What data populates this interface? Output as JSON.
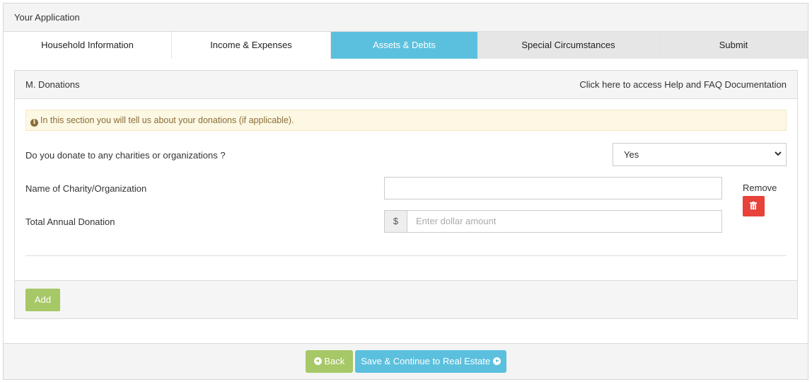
{
  "header": {
    "title": "Your Application"
  },
  "tabs": [
    {
      "label": "Household Information",
      "state": "done"
    },
    {
      "label": "Income & Expenses",
      "state": "done"
    },
    {
      "label": "Assets & Debts",
      "state": "active"
    },
    {
      "label": "Special Circumstances",
      "state": "pending"
    },
    {
      "label": "Submit",
      "state": "pending"
    }
  ],
  "panel": {
    "title": "M. Donations",
    "help_link": "Click here to access Help and FAQ Documentation",
    "alert": "In this section you will tell us about your donations (if applicable).",
    "question": "Do you donate to any charities or organizations ?",
    "answer": "Yes",
    "name_label": "Name of Charity/Organization",
    "name_value": "",
    "donation_label": "Total Annual Donation",
    "currency_symbol": "$",
    "donation_placeholder": "Enter dollar amount",
    "remove_label": "Remove",
    "add_label": "Add"
  },
  "footer": {
    "back_label": "Back",
    "save_label": "Save & Continue to Real Estate"
  },
  "colors": {
    "active_tab": "#5bc0de",
    "success": "#a6c866",
    "danger": "#e8423a",
    "alert_bg": "#fcf8e3",
    "alert_text": "#8a6d3b"
  }
}
